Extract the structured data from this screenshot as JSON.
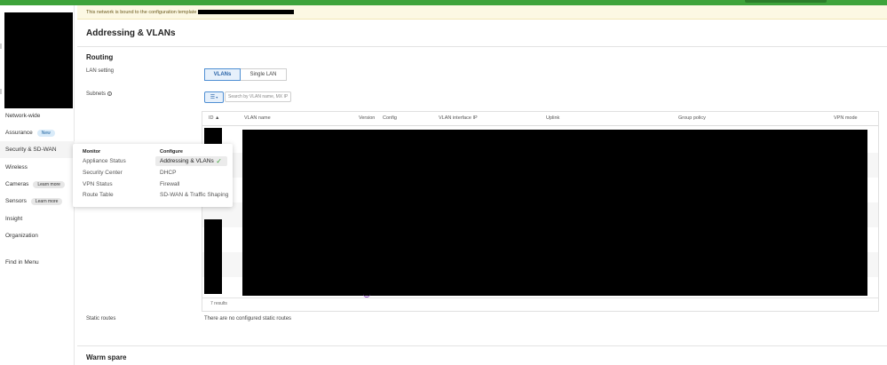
{
  "banner": {
    "text": "This network is bound to the configuration template"
  },
  "sidebar": {
    "items": [
      {
        "label": "Network-wide",
        "badge": ""
      },
      {
        "label": "Assurance",
        "badge": "New"
      },
      {
        "label": "Security & SD-WAN",
        "badge": ""
      },
      {
        "label": "Wireless",
        "badge": ""
      },
      {
        "label": "Cameras",
        "badge": "Learn more"
      },
      {
        "label": "Sensors",
        "badge": "Learn more"
      },
      {
        "label": "Insight",
        "badge": ""
      },
      {
        "label": "Organization",
        "badge": ""
      }
    ],
    "find_in_menu": "Find in Menu"
  },
  "flyout": {
    "monitor": {
      "heading": "Monitor",
      "items": [
        "Appliance Status",
        "Security Center",
        "VPN Status",
        "Route Table"
      ]
    },
    "configure": {
      "heading": "Configure",
      "selected": "Addressing & VLANs",
      "items": [
        "DHCP",
        "Firewall",
        "SD-WAN & Traffic Shaping"
      ]
    }
  },
  "page": {
    "title": "Addressing & VLANs",
    "routing": {
      "heading": "Routing",
      "lan_setting_label": "LAN setting",
      "lan_options": [
        "VLANs",
        "Single LAN"
      ],
      "lan_selected": "VLANs",
      "subnets_label": "Subnets",
      "search_placeholder": "Search by VLAN name, MX IP",
      "table": {
        "columns": [
          "ID ▲",
          "VLAN name",
          "Version",
          "Config",
          "VLAN interface IP",
          "Uplink",
          "Group policy",
          "VPN mode"
        ],
        "results": "7 results"
      },
      "static_routes_label": "Static routes",
      "static_routes_value": "There are no configured static routes"
    },
    "warm_spare": {
      "heading": "Warm spare"
    }
  }
}
